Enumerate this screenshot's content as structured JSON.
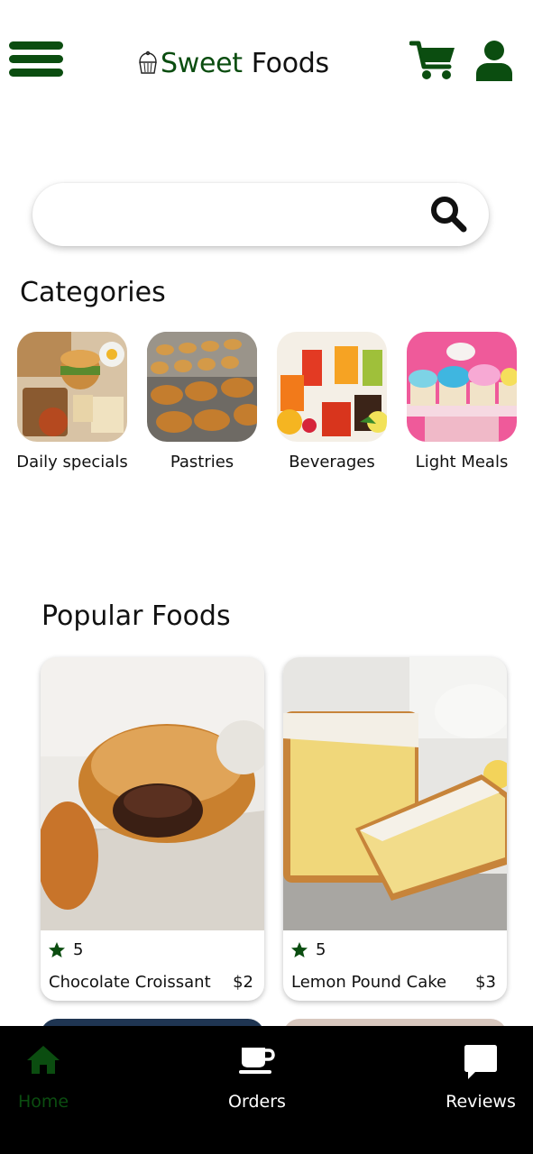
{
  "header": {
    "brand_part1": "Sweet",
    "brand_part2": "Foods",
    "brand_icon": "cupcake-icon",
    "menu_icon": "hamburger-menu-icon",
    "cart_icon": "cart-icon",
    "profile_icon": "user-icon",
    "accent_color": "#0b4d10"
  },
  "search": {
    "value": "",
    "placeholder": "",
    "icon": "search-icon"
  },
  "categories": {
    "title": "Categories",
    "items": [
      {
        "label": "Daily specials"
      },
      {
        "label": "Pastries"
      },
      {
        "label": "Beverages"
      },
      {
        "label": "Light Meals"
      }
    ]
  },
  "popular": {
    "title": "Popular Foods",
    "items": [
      {
        "rating": "5",
        "name": "Chocolate Croissant",
        "price": "$2"
      },
      {
        "rating": "5",
        "name": "Lemon Pound Cake",
        "price": "$3"
      }
    ]
  },
  "bottom_nav": {
    "active_color": "#0b4d10",
    "inactive_color": "#ffffff",
    "items": [
      {
        "label": "Home",
        "icon": "home-icon",
        "active": true
      },
      {
        "label": "Orders",
        "icon": "coffee-cup-icon",
        "active": false
      },
      {
        "label": "Reviews",
        "icon": "chat-bubble-icon",
        "active": false
      }
    ]
  }
}
